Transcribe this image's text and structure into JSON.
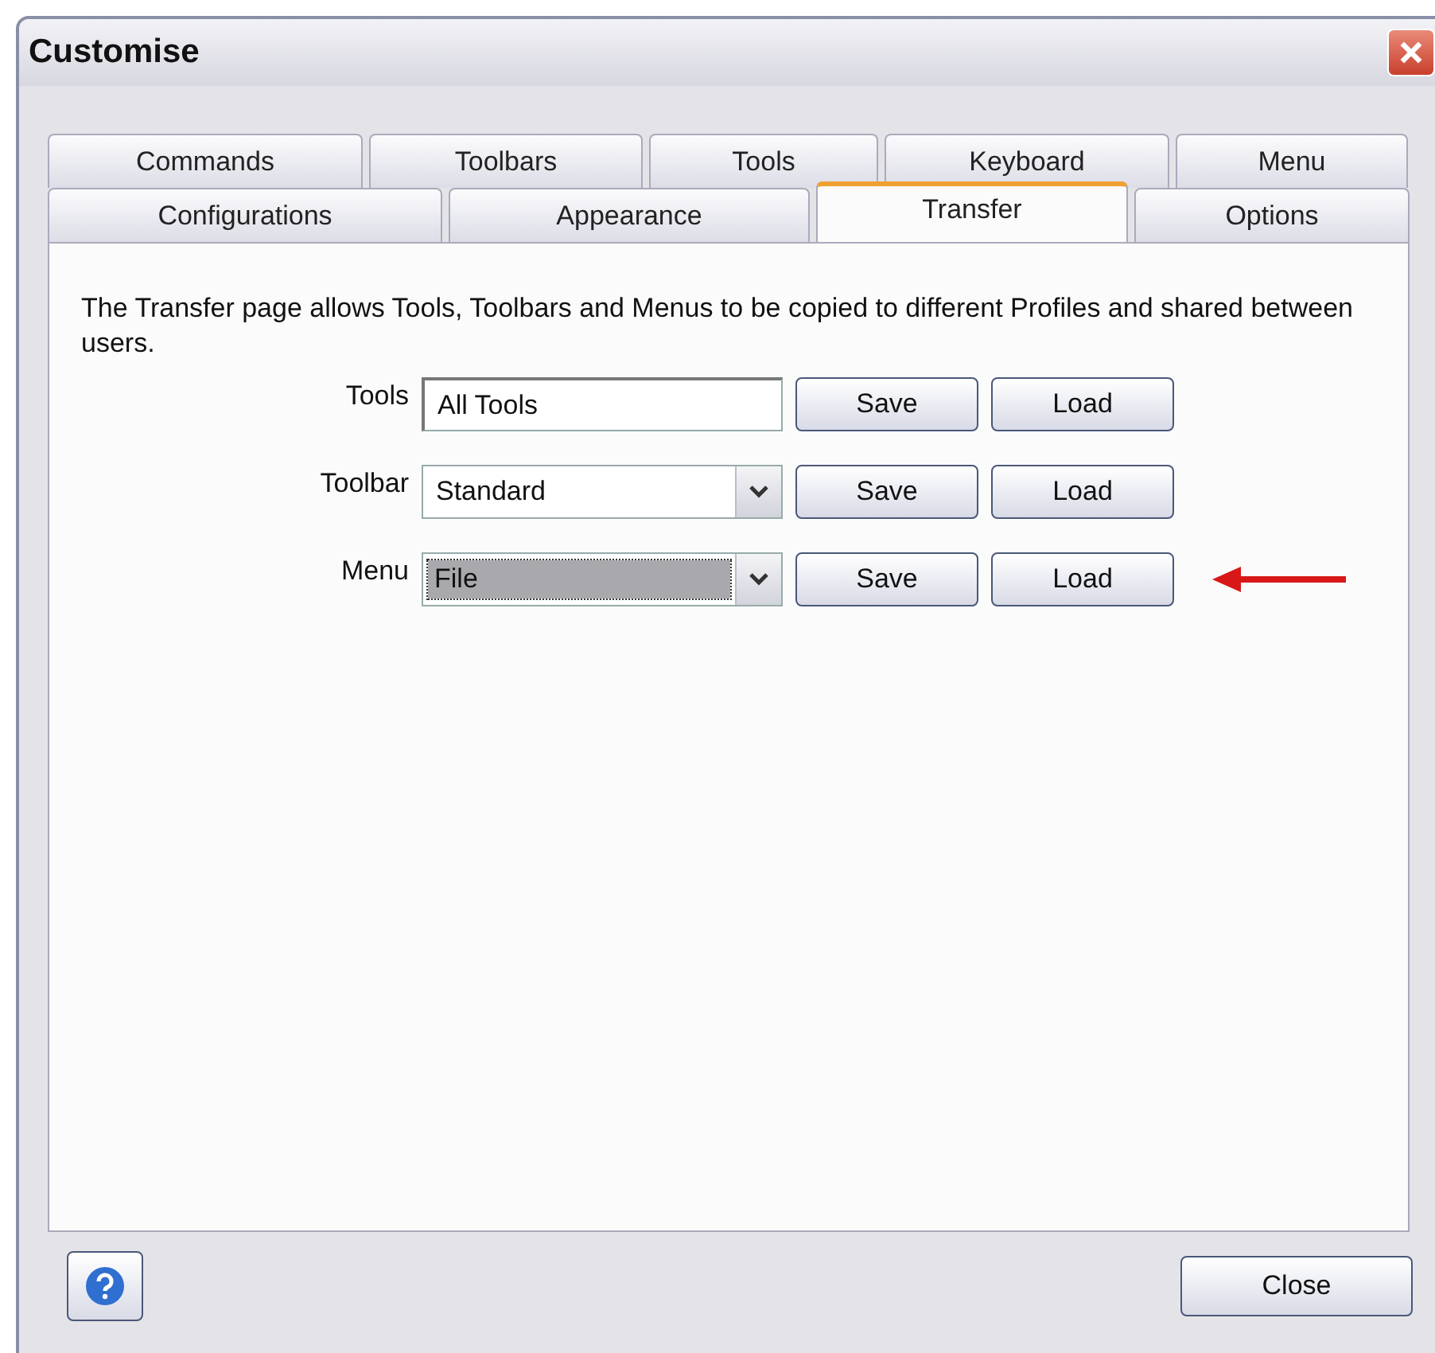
{
  "window": {
    "title": "Customise"
  },
  "tab_rows": [
    [
      {
        "label": "Commands",
        "selected": false
      },
      {
        "label": "Toolbars",
        "selected": false
      },
      {
        "label": "Tools",
        "selected": false
      },
      {
        "label": "Keyboard",
        "selected": false
      },
      {
        "label": "Menu",
        "selected": false
      }
    ],
    [
      {
        "label": "Configurations",
        "selected": false
      },
      {
        "label": "Appearance",
        "selected": false
      },
      {
        "label": "Transfer",
        "selected": true
      },
      {
        "label": "Options",
        "selected": false
      }
    ]
  ],
  "description": "The Transfer page allows Tools, Toolbars and Menus to be copied to different Profiles and shared between users.",
  "rows": [
    {
      "label": "Tools",
      "kind": "text",
      "value": "All Tools",
      "focused": false,
      "save": "Save",
      "load": "Load",
      "pointer": false
    },
    {
      "label": "Toolbar",
      "kind": "combo",
      "value": "Standard",
      "focused": false,
      "save": "Save",
      "load": "Load",
      "pointer": false
    },
    {
      "label": "Menu",
      "kind": "combo",
      "value": "File",
      "focused": true,
      "save": "Save",
      "load": "Load",
      "pointer": true
    }
  ],
  "footer": {
    "close": "Close"
  }
}
